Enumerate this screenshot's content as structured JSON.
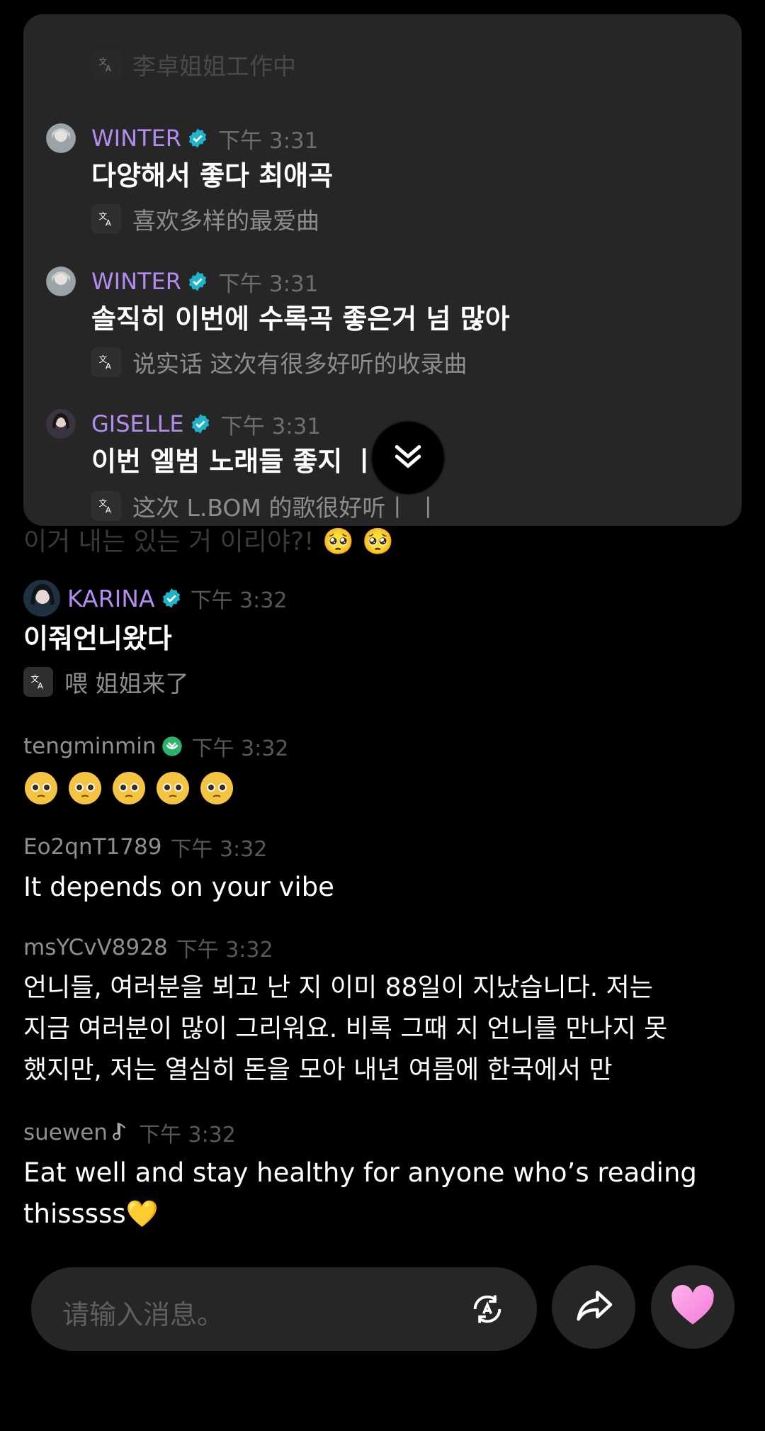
{
  "pinned": {
    "top_translation": "李卓姐姐工作中",
    "messages": [
      {
        "name": "WINTER",
        "time": "下午 3:31",
        "text": "다양해서 좋다 최애곡",
        "translation": "喜欢多样的最爱曲"
      },
      {
        "name": "WINTER",
        "time": "下午 3:31",
        "text": "솔직히 이번에 수록곡 좋은거 넘 많아",
        "translation": "说实话 这次有很多好听的收录曲"
      },
      {
        "name": "GISELLE",
        "time": "下午 3:31",
        "text": "이번 엘범 노래들 좋지     ㅣ ㅣ",
        "translation": "这次 L.BOM 的歌很好听丨 丨"
      }
    ]
  },
  "ghost_text": "이거 내는 있는 거 이리야?! 🥺 🥺",
  "chat": [
    {
      "user": "KARINA",
      "time": "下午 3:32",
      "text": "이줘언니왔다",
      "translation": "喂 姐姐来了"
    },
    {
      "user": "tengminmin",
      "time": "下午 3:32",
      "emoji_count": 5
    },
    {
      "user": "Eo2qnT1789",
      "time": "下午 3:32",
      "text": "It depends on your vibe"
    },
    {
      "user": "msYCvV8928",
      "time": "下午 3:32",
      "text_lines": [
        "언니들, 여러분을 뵈고 난 지 이미 88일이 지났습니다. 저는",
        "지금 여러분이 많이 그리워요. 비록 그때 지 언니를 만나지 못",
        "했지만, 저는 열심히 돈을 모아 내년 여름에 한국에서 만"
      ]
    },
    {
      "user": "suewen",
      "time": "下午 3:32",
      "text_lines": [
        "Eat well and stay healthy for anyone who’s reading",
        "thisssss💛"
      ]
    }
  ],
  "input": {
    "placeholder": "请输入消息。"
  },
  "icons": {
    "translate": "translate-icon",
    "verified": "verified-icon",
    "share": "share-icon",
    "like": "heart-icon",
    "scroll": "chevron-double-down-icon",
    "music": "music-note-icon"
  },
  "colors": {
    "accent_name": "#b48cf0",
    "verified": "#1fb4c9",
    "verified_green": "#2bb36b",
    "heart": "#ff9ee8"
  }
}
